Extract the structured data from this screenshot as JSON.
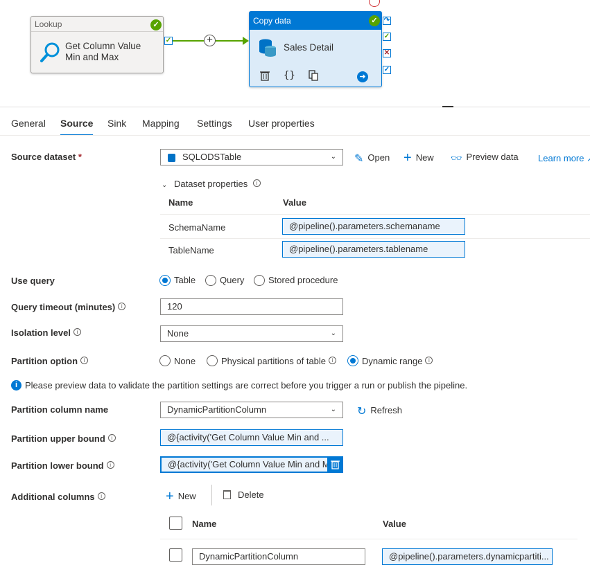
{
  "canvas": {
    "lookup": {
      "type": "Lookup",
      "name_line1": "Get Column Value",
      "name_line2": "Min and Max"
    },
    "copy": {
      "type": "Copy data",
      "name": "Sales Detail"
    }
  },
  "tabs": [
    "General",
    "Source",
    "Sink",
    "Mapping",
    "Settings",
    "User properties"
  ],
  "active_tab": "Source",
  "source_dataset": {
    "label": "Source dataset",
    "required": "*",
    "value": "SQLODSTable",
    "open": "Open",
    "new": "New",
    "preview": "Preview data",
    "learn_more": "Learn more"
  },
  "dataset_properties": {
    "title": "Dataset properties",
    "col_name": "Name",
    "col_value": "Value",
    "rows": [
      {
        "name": "SchemaName",
        "value": "@pipeline().parameters.schemaname"
      },
      {
        "name": "TableName",
        "value": "@pipeline().parameters.tablename"
      }
    ]
  },
  "use_query": {
    "label": "Use query",
    "options": [
      "Table",
      "Query",
      "Stored procedure"
    ],
    "selected": "Table"
  },
  "query_timeout": {
    "label": "Query timeout (minutes)",
    "value": "120"
  },
  "isolation_level": {
    "label": "Isolation level",
    "value": "None"
  },
  "partition_option": {
    "label": "Partition option",
    "options": [
      "None",
      "Physical partitions of table",
      "Dynamic range"
    ],
    "selected": "Dynamic range"
  },
  "notice": "Please preview data to validate the partition settings are correct before you trigger a run or publish the pipeline.",
  "partition_column": {
    "label": "Partition column name",
    "value": "DynamicPartitionColumn",
    "refresh": "Refresh"
  },
  "upper_bound": {
    "label": "Partition upper bound",
    "value": "@{activity('Get Column Value Min and ..."
  },
  "lower_bound": {
    "label": "Partition lower bound",
    "value": "@{activity('Get Column Value Min and M"
  },
  "additional_columns": {
    "label": "Additional columns",
    "new": "New",
    "delete": "Delete",
    "col_name": "Name",
    "col_value": "Value",
    "rows": [
      {
        "name": "DynamicPartitionColumn",
        "value": "@pipeline().parameters.dynamicpartiti..."
      }
    ]
  },
  "colors": {
    "accent": "#0078d4",
    "success": "#57a300",
    "error": "#a4262c"
  }
}
